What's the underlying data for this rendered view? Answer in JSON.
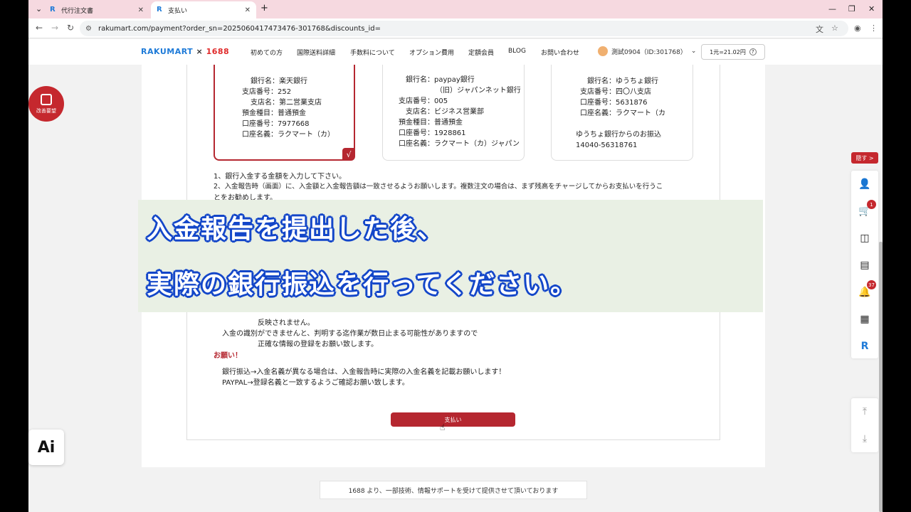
{
  "browser": {
    "tabs": [
      {
        "title": "代行注文書",
        "active": false
      },
      {
        "title": "支払い",
        "active": true
      }
    ],
    "url": "rakumart.com/payment?order_sn=2025060417473476-301768&discounts_id="
  },
  "header": {
    "logo_main": "RAKUMART",
    "logo_sep": " × ",
    "logo_partner": "1688",
    "nav": [
      "初めての方",
      "国際送料詳細",
      "手数料について",
      "オプション費用",
      "定額会員",
      "BLOG",
      "お問い合わせ"
    ],
    "user": "測試0904（ID:301768）",
    "rate": "1元=21.02円"
  },
  "banks": [
    {
      "lines": [
        "銀行名：楽天銀行",
        "支店番号：252",
        "支店名：第二営業支店",
        "預金種目：普通預金",
        "口座番号：7977668",
        "口座名義：ラクマート（カ）"
      ],
      "selected": true,
      "check": "√"
    },
    {
      "lines": [
        "銀行名：paypay銀行",
        "（旧）ジャパンネット銀行",
        "支店番号：005",
        "支店名：ビジネス営業部",
        "預金種目：普通預金",
        "口座番号：1928861",
        "口座名義：ラクマート（カ）ジャパン"
      ],
      "selected": false
    },
    {
      "lines": [
        "銀行名：ゆうちょ銀行",
        "支店番号：四〇八支店",
        "口座番号：5631876",
        "口座名義：ラクマート（カ",
        "",
        "ゆうちょ銀行からのお振込",
        "14040-56318761"
      ],
      "selected": false
    }
  ],
  "notes": {
    "n1": "1、銀行入金する金額を入力して下さい。",
    "n2a": "2、入金報告時（画面）に、入金額と入金報告額は一致させるようお願いします。複数注文の場合は、まず残高をチャージしてからお支払いを行うこ",
    "n2b": "とをお勧めします。",
    "n3": "反映されません。",
    "n4": "入金の識別ができませんと、判明する迄作業が数日止まる可能性がありますので",
    "n5": "正確な情報の登録をお願い致します。",
    "request_title": "お願い！",
    "r1": "銀行振込→入金名義が異なる場合は、入金報告時に実際の入金名義を記載お願いします！",
    "r2": "PAYPAL→登録名義と一致するようご確認お願い致します。"
  },
  "pay_button": "支払い",
  "footer": "1688 より、一部技術、情報サポートを受けて提供させて頂いております",
  "caption": {
    "line1": "入金報告を提出した後、",
    "line2": "実際の銀行振込を行ってください。"
  },
  "widgets": {
    "improve": "改善要望",
    "ai": "Ai",
    "hide": "隠す >",
    "cart_badge": "1",
    "notice_badge": "37"
  }
}
